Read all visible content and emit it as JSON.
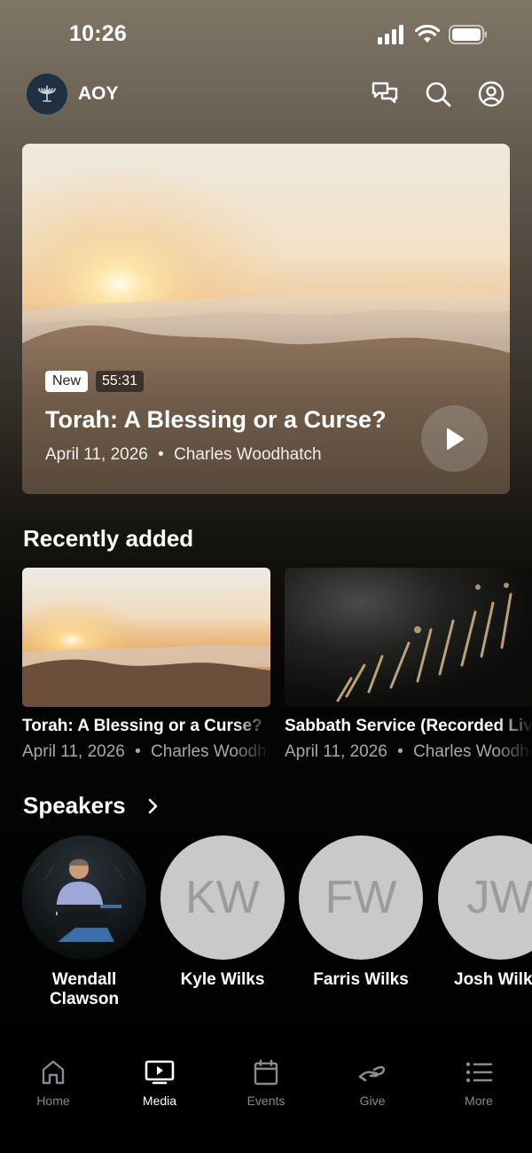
{
  "status_bar": {
    "time": "10:26"
  },
  "header": {
    "app_name": "AOY"
  },
  "featured": {
    "badge_new": "New",
    "duration": "55:31",
    "title": "Torah: A Blessing or a Curse?",
    "date": "April 11, 2026",
    "speaker": "Charles Woodhatch",
    "separator": "•"
  },
  "recently_added": {
    "heading": "Recently added",
    "items": [
      {
        "title": "Torah: A Blessing or a Curse?",
        "date": "April 11, 2026",
        "speaker": "Charles Woodhatch",
        "separator": "•"
      },
      {
        "title": "Sabbath Service (Recorded Live)",
        "date": "April 11, 2026",
        "speaker": "Charles Woodhatch",
        "separator": "•"
      }
    ]
  },
  "speakers": {
    "heading": "Speakers",
    "items": [
      {
        "name": "Wendall Clawson",
        "initials": ""
      },
      {
        "name": "Kyle Wilks",
        "initials": "KW"
      },
      {
        "name": "Farris Wilks",
        "initials": "FW"
      },
      {
        "name": "Josh Wilks",
        "initials": "JW"
      }
    ]
  },
  "tabs": [
    {
      "label": "Home",
      "icon": "home-icon",
      "active": false
    },
    {
      "label": "Media",
      "icon": "tv-play-icon",
      "active": true
    },
    {
      "label": "Events",
      "icon": "calendar-icon",
      "active": false
    },
    {
      "label": "Give",
      "icon": "give-icon",
      "active": false
    },
    {
      "label": "More",
      "icon": "list-icon",
      "active": false
    }
  ],
  "colors": {
    "accent_active": "#ffffff",
    "tab_inactive": "#8a8a8e",
    "avatar_placeholder": "#c9c9cc"
  }
}
